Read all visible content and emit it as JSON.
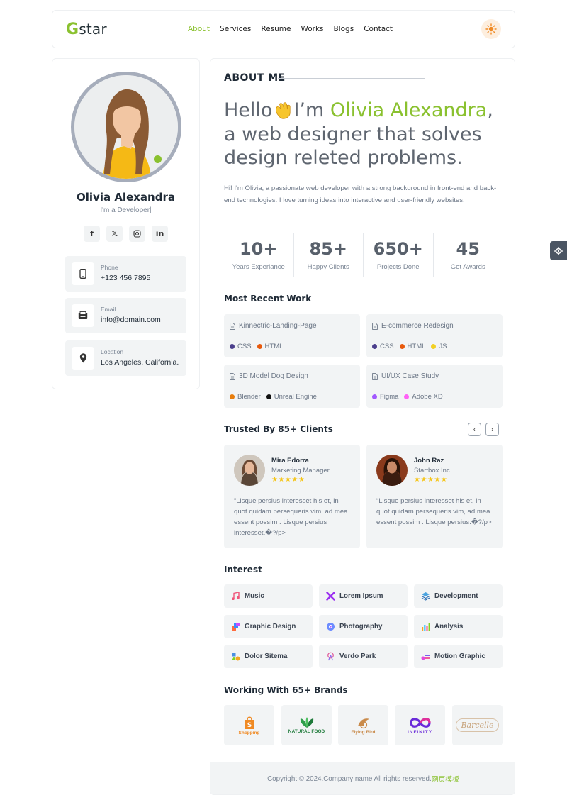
{
  "header": {
    "logo_g": "G",
    "logo_rest": "star",
    "nav": [
      "About",
      "Services",
      "Resume",
      "Works",
      "Blogs",
      "Contact"
    ],
    "active_nav": "About",
    "theme_icon": "sun-icon"
  },
  "profile": {
    "name": "Olivia Alexandra",
    "role": "I'm a Developer|",
    "socials": [
      "facebook-icon",
      "x-icon",
      "instagram-icon",
      "linkedin-icon"
    ],
    "info": [
      {
        "label": "Phone",
        "value": "+123 456 7895",
        "icon": "phone-icon"
      },
      {
        "label": "Email",
        "value": "info@domain.com",
        "icon": "inbox-icon"
      },
      {
        "label": "Location",
        "value": "Los Angeles, California.",
        "icon": "location-pin-icon"
      }
    ]
  },
  "about": {
    "heading": "ABOUT ME",
    "hero_pre": "Hello",
    "hero_im": "I’m ",
    "hero_name": "Olivia Alexandra",
    "hero_post": ", a web designer that solves design releted problems.",
    "intro": "Hi! I'm Olivia, a passionate web developer with a strong background in front-end and back-end technologies. I love turning ideas into interactive and user-friendly websites."
  },
  "stats": [
    {
      "num": "10+",
      "cap": "Years Experiance"
    },
    {
      "num": "85+",
      "cap": "Happy Clients"
    },
    {
      "num": "650+",
      "cap": "Projects Done"
    },
    {
      "num": "45",
      "cap": "Get Awards"
    }
  ],
  "recent_work": {
    "title": "Most Recent Work",
    "items": [
      {
        "title": "Kinnectric-Landing-Page",
        "tags": [
          {
            "t": "CSS",
            "c": "#4b3f8c"
          },
          {
            "t": "HTML",
            "c": "#e8590c"
          }
        ]
      },
      {
        "title": "E-commerce Redesign",
        "tags": [
          {
            "t": "CSS",
            "c": "#4b3f8c"
          },
          {
            "t": "HTML",
            "c": "#e8590c"
          },
          {
            "t": "JS",
            "c": "#f2d024"
          }
        ]
      },
      {
        "title": "3D Model Dog Design",
        "tags": [
          {
            "t": "Blender",
            "c": "#e87d0d"
          },
          {
            "t": "Unreal Engine",
            "c": "#111111"
          }
        ]
      },
      {
        "title": "UI/UX Case Study",
        "tags": [
          {
            "t": "Figma",
            "c": "#a259ff"
          },
          {
            "t": "Adobe XD",
            "c": "#ff61f6"
          }
        ]
      }
    ]
  },
  "clients": {
    "title": "Trusted By 85+ Clients",
    "prev": "‹",
    "next": "›",
    "items": [
      {
        "name": "Mira Edorra",
        "role": "Marketing Manager",
        "stars": "★★★★★",
        "quote": "“Lisque persius interesset his et, in quot quidam persequeris vim, ad mea essent possim . Lisque persius interesset.�?/p>"
      },
      {
        "name": "John Raz",
        "role": "Startbox Inc.",
        "stars": "★★★★★",
        "quote": "“Lisque persius interesset his et, in quot quidam persequeris vim, ad mea essent possim . Lisque persius.�?/p>"
      }
    ]
  },
  "interest": {
    "title": "Interest",
    "items": [
      {
        "label": "Music",
        "icon": "music-note-icon"
      },
      {
        "label": "Lorem Ipsum",
        "icon": "crossed-tools-icon"
      },
      {
        "label": "Development",
        "icon": "layers-icon"
      },
      {
        "label": "Graphic Design",
        "icon": "color-palette-icon"
      },
      {
        "label": "Photography",
        "icon": "camera-lens-icon"
      },
      {
        "label": "Analysis",
        "icon": "bar-chart-icon"
      },
      {
        "label": "Dolor Sitema",
        "icon": "shapes-icon"
      },
      {
        "label": "Verdo Park",
        "icon": "ferris-wheel-icon"
      },
      {
        "label": "Motion Graphic",
        "icon": "motion-icon"
      }
    ]
  },
  "brands": {
    "title": "Working With 65+ Brands",
    "items": [
      {
        "name": "Shopping",
        "color": "#f08a24"
      },
      {
        "name": "NATURAL FOOD",
        "color": "#1e7a3a"
      },
      {
        "name": "Flying Bird",
        "color": "#c98a4a"
      },
      {
        "name": "INFINITY",
        "color": "#6a2bd9"
      },
      {
        "name": "Barcelle",
        "color": "#c7a27a"
      }
    ]
  },
  "footer": {
    "text": "Copyright © 2024.Company name All rights reserved.",
    "link": "网页模板"
  }
}
